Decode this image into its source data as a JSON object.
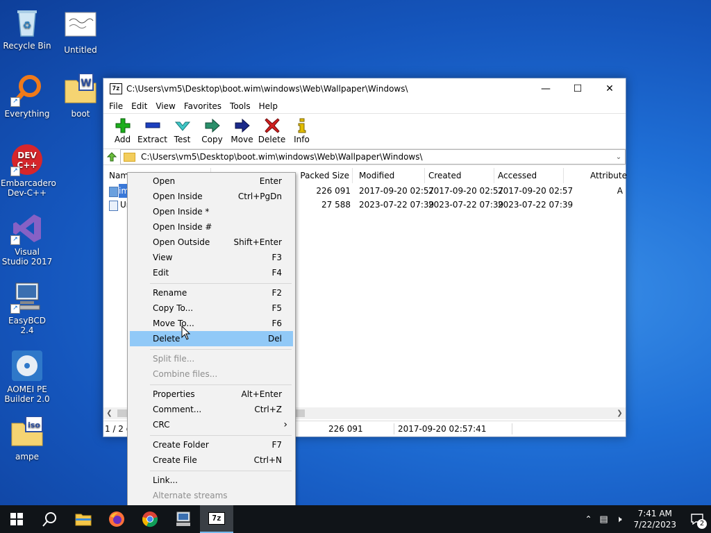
{
  "desktop": {
    "icons": [
      {
        "label": "Recycle Bin"
      },
      {
        "label": "Untitled"
      },
      {
        "label": "Everything"
      },
      {
        "label": "boot"
      },
      {
        "label": "Embarcadero Dev-C++"
      },
      {
        "label": "Visual Studio 2017"
      },
      {
        "label": "EasyBCD 2.4"
      },
      {
        "label": "AOMEI PE Builder 2.0"
      },
      {
        "label": "ampe"
      }
    ]
  },
  "window": {
    "title": "C:\\Users\\vm5\\Desktop\\boot.wim\\windows\\Web\\Wallpaper\\Windows\\",
    "app_icon": "7z",
    "menu": [
      "File",
      "Edit",
      "View",
      "Favorites",
      "Tools",
      "Help"
    ],
    "toolbar": [
      {
        "label": "Add",
        "icon": "plus-icon",
        "color": "#1cae1c"
      },
      {
        "label": "Extract",
        "icon": "minus-icon",
        "color": "#1c3fbf"
      },
      {
        "label": "Test",
        "icon": "check-icon",
        "color": "#3fbfbf"
      },
      {
        "label": "Copy",
        "icon": "copy-arrow-icon",
        "color": "#2a8f6a"
      },
      {
        "label": "Move",
        "icon": "move-arrow-icon",
        "color": "#1b2a8a"
      },
      {
        "label": "Delete",
        "icon": "x-icon",
        "color": "#d11f1f"
      },
      {
        "label": "Info",
        "icon": "info-icon",
        "color": "#d9b400"
      }
    ],
    "address": "C:\\Users\\vm5\\Desktop\\boot.wim\\windows\\Web\\Wallpaper\\Windows\\",
    "columns": [
      "Nam",
      "Packed Size",
      "Modified",
      "Created",
      "Accessed",
      "Attribute"
    ],
    "rows": [
      {
        "name": "im",
        "packed": "226 091",
        "modified": "2017-09-20 02:57",
        "created": "2017-09-20 02:57",
        "accessed": "2017-09-20 02:57",
        "attr": "A",
        "selected": true
      },
      {
        "name": "Ur",
        "packed": "27 588",
        "modified": "2023-07-22 07:39",
        "created": "2023-07-22 07:39",
        "accessed": "2023-07-22 07:39",
        "attr": "",
        "selected": false
      }
    ],
    "status": {
      "count": "1 / 2 o",
      "size": "226 091",
      "date": "2017-09-20 02:57:41"
    }
  },
  "context_menu": {
    "items": [
      {
        "label": "Open",
        "shortcut": "Enter"
      },
      {
        "label": "Open Inside",
        "shortcut": "Ctrl+PgDn"
      },
      {
        "label": "Open Inside *",
        "shortcut": ""
      },
      {
        "label": "Open Inside #",
        "shortcut": ""
      },
      {
        "label": "Open Outside",
        "shortcut": "Shift+Enter"
      },
      {
        "label": "View",
        "shortcut": "F3"
      },
      {
        "label": "Edit",
        "shortcut": "F4"
      },
      {
        "label": "Rename",
        "shortcut": "F2"
      },
      {
        "label": "Copy To...",
        "shortcut": "F5"
      },
      {
        "label": "Move To...",
        "shortcut": "F6"
      },
      {
        "label": "Delete",
        "shortcut": "Del"
      },
      {
        "label": "Split file...",
        "shortcut": ""
      },
      {
        "label": "Combine files...",
        "shortcut": ""
      },
      {
        "label": "Properties",
        "shortcut": "Alt+Enter"
      },
      {
        "label": "Comment...",
        "shortcut": "Ctrl+Z"
      },
      {
        "label": "CRC",
        "shortcut": "›"
      },
      {
        "label": "Create Folder",
        "shortcut": "F7"
      },
      {
        "label": "Create File",
        "shortcut": "Ctrl+N"
      },
      {
        "label": "Link...",
        "shortcut": ""
      },
      {
        "label": "Alternate streams",
        "shortcut": ""
      }
    ]
  },
  "taskbar": {
    "time": "7:41 AM",
    "date": "7/22/2023",
    "notifications": "2"
  },
  "colors": {
    "highlight": "#91c9f7",
    "taskbar": "#101418",
    "accent": "#76b9ed"
  }
}
